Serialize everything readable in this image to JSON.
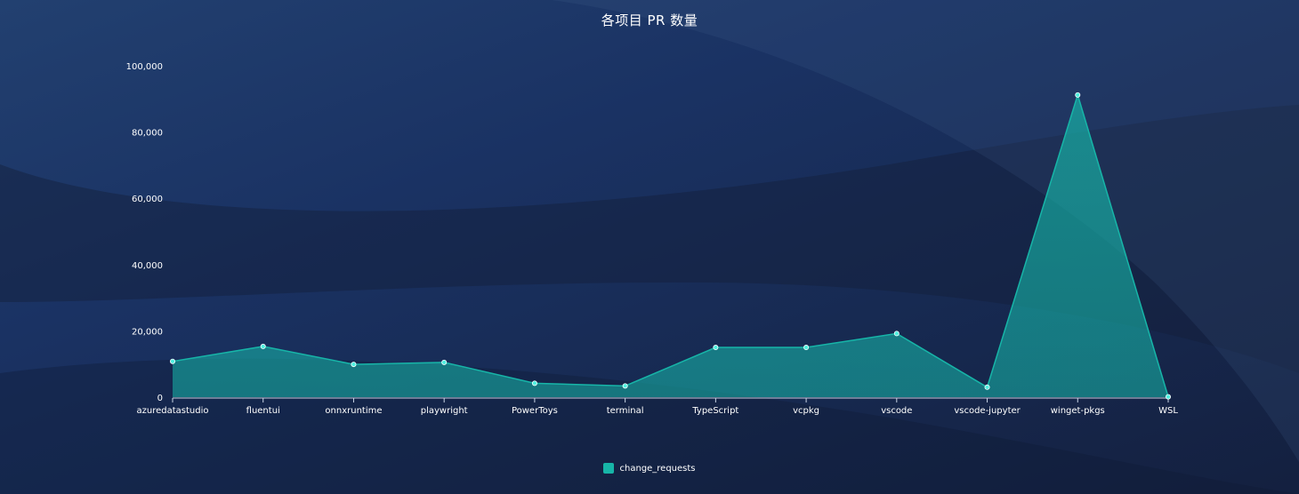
{
  "colors": {
    "series": "#17b5a8",
    "point": "#4ff0e0",
    "axis": "#c9d4e5",
    "text": "#ffffff"
  },
  "chart_data": {
    "type": "area",
    "title": "各项目 PR 数量",
    "xlabel": "",
    "ylabel": "",
    "ylim": [
      0,
      100000
    ],
    "yticks": [
      0,
      20000,
      40000,
      60000,
      80000,
      100000
    ],
    "ytick_labels": [
      "0",
      "20,000",
      "40,000",
      "60,000",
      "80,000",
      "100,000"
    ],
    "grid": false,
    "legend_position": "bottom-center",
    "categories": [
      "azuredatastudio",
      "fluentui",
      "onnxruntime",
      "playwright",
      "PowerToys",
      "terminal",
      "TypeScript",
      "vcpkg",
      "vscode",
      "vscode-jupyter",
      "winget-pkgs",
      "WSL"
    ],
    "series": [
      {
        "name": "change_requests",
        "values": [
          10800,
          15300,
          9900,
          10500,
          4200,
          3400,
          15000,
          15000,
          19200,
          3000,
          91200,
          100
        ]
      }
    ]
  }
}
